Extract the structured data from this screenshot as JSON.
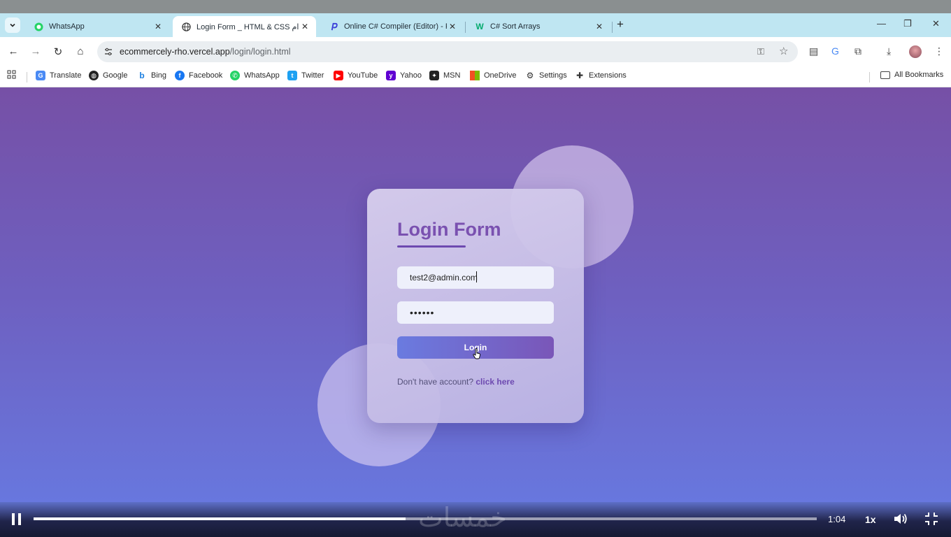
{
  "browser": {
    "tabs": [
      {
        "title": "WhatsApp",
        "icon": "whatsapp-icon",
        "active": false
      },
      {
        "title": "Login Form _ HTML & CSS مستخدام",
        "icon": "globe-icon",
        "active": true
      },
      {
        "title": "Online C# Compiler (Editor) - P",
        "icon": "programiz-icon",
        "active": false
      },
      {
        "title": "C# Sort Arrays",
        "icon": "w3schools-icon",
        "active": false
      }
    ],
    "url_host": "ecommercely-rho.vercel.app",
    "url_path": "/login/login.html",
    "bookmarks": [
      {
        "label": "Translate",
        "color": "#4a8af4"
      },
      {
        "label": "Google",
        "color": "#222222"
      },
      {
        "label": "Bing",
        "color": "#1b7fe0"
      },
      {
        "label": "Facebook",
        "color": "#1877f2"
      },
      {
        "label": "WhatsApp",
        "color": "#25d366"
      },
      {
        "label": "Twitter",
        "color": "#1da1f2"
      },
      {
        "label": "YouTube",
        "color": "#ff0000"
      },
      {
        "label": "Yahoo",
        "color": "#6001d2"
      },
      {
        "label": "MSN",
        "color": "#222222"
      },
      {
        "label": "OneDrive",
        "color": "#f25022"
      },
      {
        "label": "Settings",
        "color": "#333333"
      },
      {
        "label": "Extensions",
        "color": "#333333"
      }
    ],
    "all_bookmarks": "All Bookmarks"
  },
  "page": {
    "form_title": "Login Form",
    "email_value": "test2@admin.com",
    "password_value": "••••••",
    "login_label": "Login",
    "signup_text": "Don't have account?",
    "signup_link": "click here",
    "accent_color": "#7a51b0"
  },
  "video": {
    "time": "1:04",
    "speed": "1x",
    "progress_fraction": 0.475,
    "watermark": "خمسات"
  }
}
